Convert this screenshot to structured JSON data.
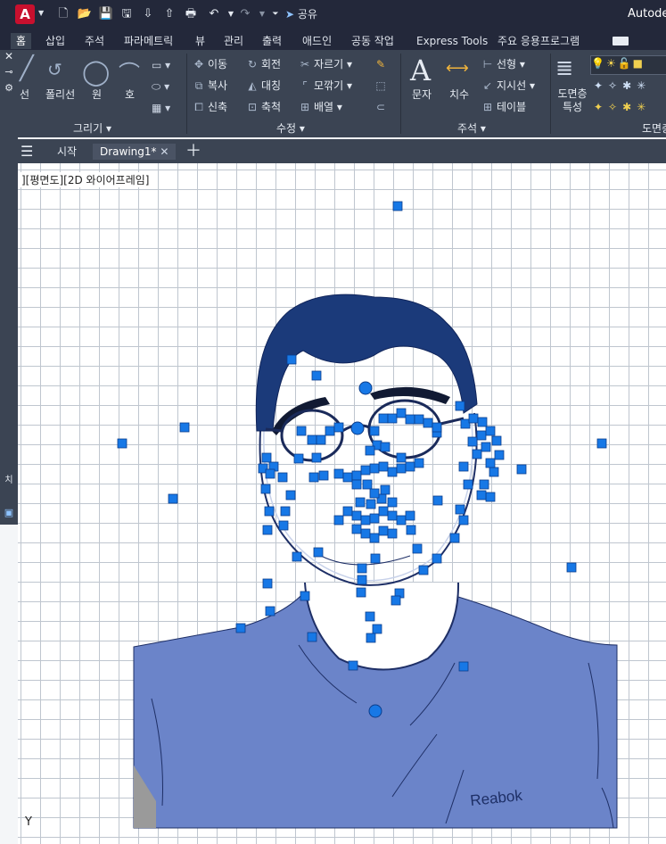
{
  "app": {
    "title": "Autodes",
    "logo_letter": "A"
  },
  "quick_access": {
    "share_label": "공유"
  },
  "ribbon_tabs": [
    "홈",
    "삽입",
    "주석",
    "파라메트릭",
    "뷰",
    "관리",
    "출력",
    "애드인",
    "공동 작업",
    "Express Tools",
    "주요 응용프로그램"
  ],
  "ribbon": {
    "draw": {
      "title": "그리기",
      "line": "선",
      "polyline": "폴리선",
      "circle": "원",
      "arc": "호"
    },
    "modify": {
      "title": "수정",
      "move": "이동",
      "rotate": "회전",
      "trim": "자르기",
      "copy": "복사",
      "mirror": "대칭",
      "fillet": "모깎기",
      "stretch": "신축",
      "scale": "축척",
      "array": "배열"
    },
    "annotation": {
      "title": "주석",
      "text": "문자",
      "dimension": "치수",
      "linear": "선형",
      "leader": "지시선",
      "table": "테이블"
    },
    "layers": {
      "title": "도면층",
      "properties": "도면층 특성"
    }
  },
  "doc_tabs": {
    "start": "시작",
    "drawing": "Drawing1*"
  },
  "palette_label": "치",
  "viewport": {
    "label": "][평면도][2D 와이어프레임]",
    "ucs_axis": "Y"
  },
  "drawing": {
    "shirt_text": "Reabok"
  },
  "colors": {
    "hair": "#1b3a7a",
    "shirt": "#6b84c9",
    "grip": "#1778e6",
    "glasses": "#1a2a5a",
    "outline": "#1e2f66"
  }
}
